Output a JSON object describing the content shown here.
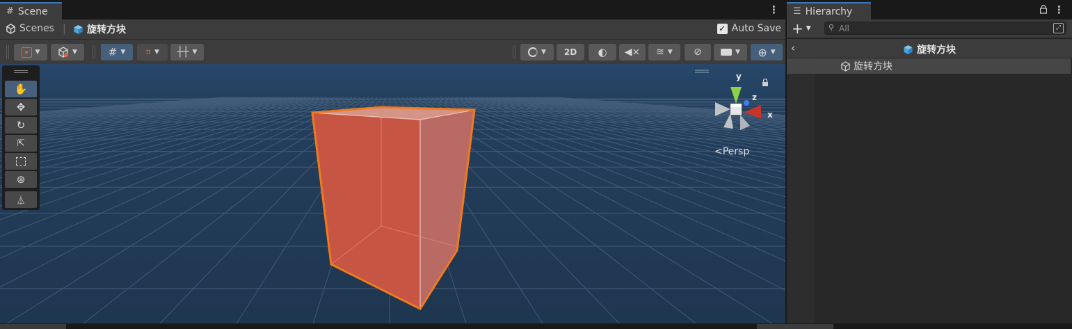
{
  "scene": {
    "tab_title": "Scene",
    "tab_icon": "grid-icon",
    "breadcrumb_root": "Scenes",
    "breadcrumb_current": "旋转方块",
    "auto_save_label": "Auto Save",
    "auto_save_checked": true,
    "toolbar": {
      "mode_2d_label": "2D"
    },
    "tools": [
      "hand-tool",
      "move-tool",
      "rotate-tool",
      "scale-tool",
      "rect-tool",
      "transform-tool",
      "custom-tool"
    ],
    "active_tool": "hand-tool",
    "gizmo": {
      "x_label": "x",
      "y_label": "y",
      "z_label": "z",
      "projection_label": "<Persp",
      "x_color": "#c8342a",
      "y_color": "#8bd14a",
      "z_color": "#3d7df0"
    },
    "viewport_colors": {
      "sky": "#223a55",
      "grid": "#5c7590",
      "cube_face": "#c85a48",
      "cube_outline": "#f07a1e"
    }
  },
  "hierarchy": {
    "tab_title": "Hierarchy",
    "search_placeholder": "All",
    "scene_title": "旋转方块",
    "items": [
      {
        "label": "旋转方块",
        "selected": true
      }
    ]
  },
  "colors": {
    "accent_tab": "#3a79bb",
    "active_button": "#46607c",
    "panel": "#282828",
    "toolbar": "#3c3c3c"
  }
}
